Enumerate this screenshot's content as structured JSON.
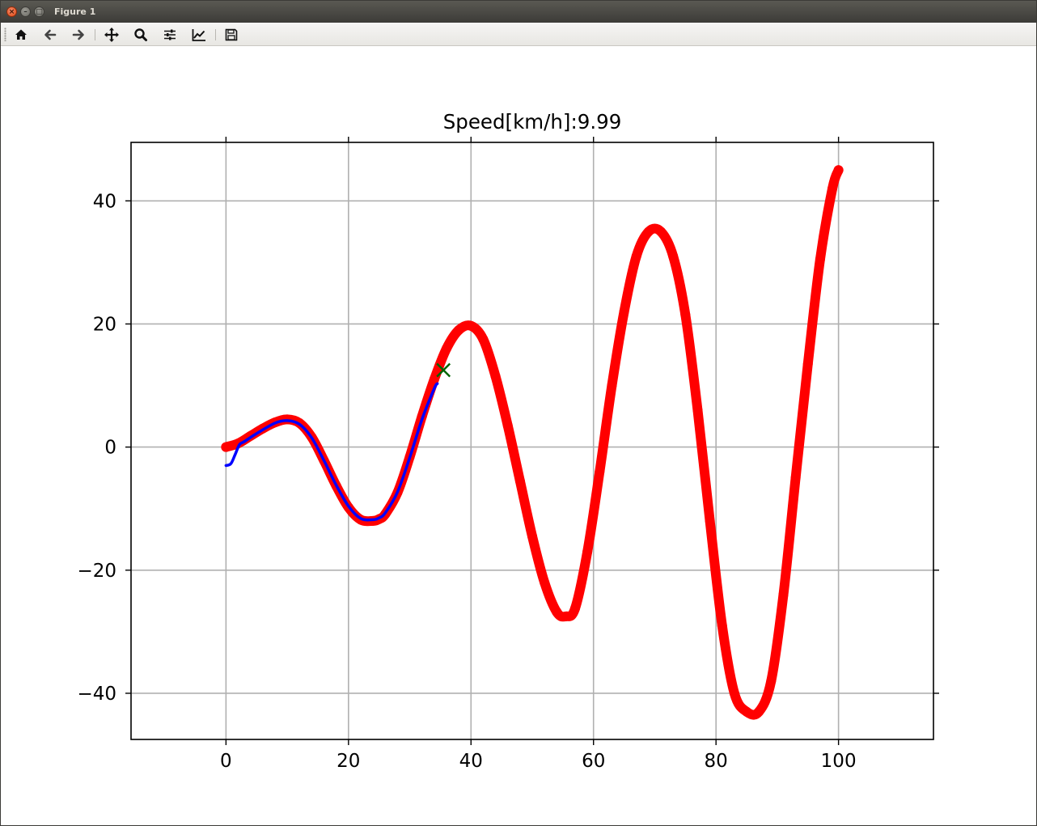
{
  "window": {
    "title": "Figure 1"
  },
  "toolbar": {
    "buttons": [
      {
        "name": "home-button",
        "icon": "home-icon"
      },
      {
        "name": "back-button",
        "icon": "arrow-left-icon"
      },
      {
        "name": "forward-button",
        "icon": "arrow-right-icon"
      },
      {
        "name": "pan-button",
        "icon": "move-arrows-icon"
      },
      {
        "name": "zoom-button",
        "icon": "magnifier-icon"
      },
      {
        "name": "subplots-button",
        "icon": "sliders-icon"
      },
      {
        "name": "edit-axes-button",
        "icon": "line-chart-icon"
      },
      {
        "name": "save-button",
        "icon": "floppy-disk-icon"
      }
    ]
  },
  "chart_data": {
    "type": "line",
    "title": "Speed[km/h]:9.99",
    "xlabel": "",
    "ylabel": "",
    "xlim": [
      -15.5,
      115.5
    ],
    "ylim": [
      -47.5,
      49.5
    ],
    "xticks": [
      0,
      20,
      40,
      60,
      80,
      100
    ],
    "xtick_labels": [
      "0",
      "20",
      "40",
      "60",
      "80",
      "100"
    ],
    "yticks": [
      -40,
      -20,
      0,
      20,
      40
    ],
    "ytick_labels": [
      "−40",
      "−20",
      "0",
      "20",
      "40"
    ],
    "grid": true,
    "series": [
      {
        "style": "thick red dots",
        "color": "#ff0000",
        "x": [
          0,
          2,
          4,
          6,
          8,
          10,
          12,
          14,
          16,
          18,
          20,
          22,
          24,
          25,
          26,
          28,
          30,
          32,
          34,
          36,
          38,
          40,
          42,
          44,
          46,
          48,
          50,
          52,
          54,
          55.5,
          57,
          59,
          61,
          63,
          65,
          67,
          69,
          71,
          73,
          75,
          77,
          79,
          81,
          83,
          85,
          87,
          89,
          91,
          93,
          95,
          97,
          99,
          100
        ],
        "y": [
          0,
          0.6,
          1.8,
          3.0,
          4.0,
          4.5,
          3.9,
          1.6,
          -2.2,
          -6.3,
          -9.8,
          -11.8,
          -12.0,
          -11.7,
          -10.9,
          -7.4,
          -1.6,
          5.0,
          11.0,
          16.0,
          19.0,
          19.7,
          17.5,
          11.5,
          3.5,
          -5.5,
          -14.5,
          -22.0,
          -26.8,
          -27.5,
          -26.2,
          -17.0,
          -4.0,
          10.0,
          22.0,
          31.0,
          35.0,
          35.0,
          31.0,
          21.5,
          6.0,
          -12.0,
          -29.0,
          -40.0,
          -43.0,
          -43.0,
          -38.0,
          -24.0,
          -5.0,
          13.5,
          30.5,
          42.0,
          45.0
        ]
      },
      {
        "style": "blue line",
        "color": "#0000ff",
        "x": [
          0,
          0.8,
          1.5,
          2.2,
          3.0,
          5.0,
          8.0,
          10.0,
          12.0,
          14.0,
          16.0,
          18.0,
          20.0,
          22.0,
          24.0,
          25.0,
          26.0,
          28.0,
          30.0,
          32.0,
          34.0,
          34.5
        ],
        "y": [
          -3.0,
          -2.7,
          -1.2,
          0.4,
          0.9,
          2.2,
          3.9,
          4.3,
          3.7,
          1.5,
          -2.2,
          -6.2,
          -9.6,
          -11.6,
          -11.8,
          -11.5,
          -10.7,
          -7.3,
          -1.7,
          4.5,
          9.5,
          10.3
        ]
      },
      {
        "style": "green x marker",
        "color": "#006400",
        "x": [
          35.5
        ],
        "y": [
          12.5
        ]
      }
    ]
  }
}
